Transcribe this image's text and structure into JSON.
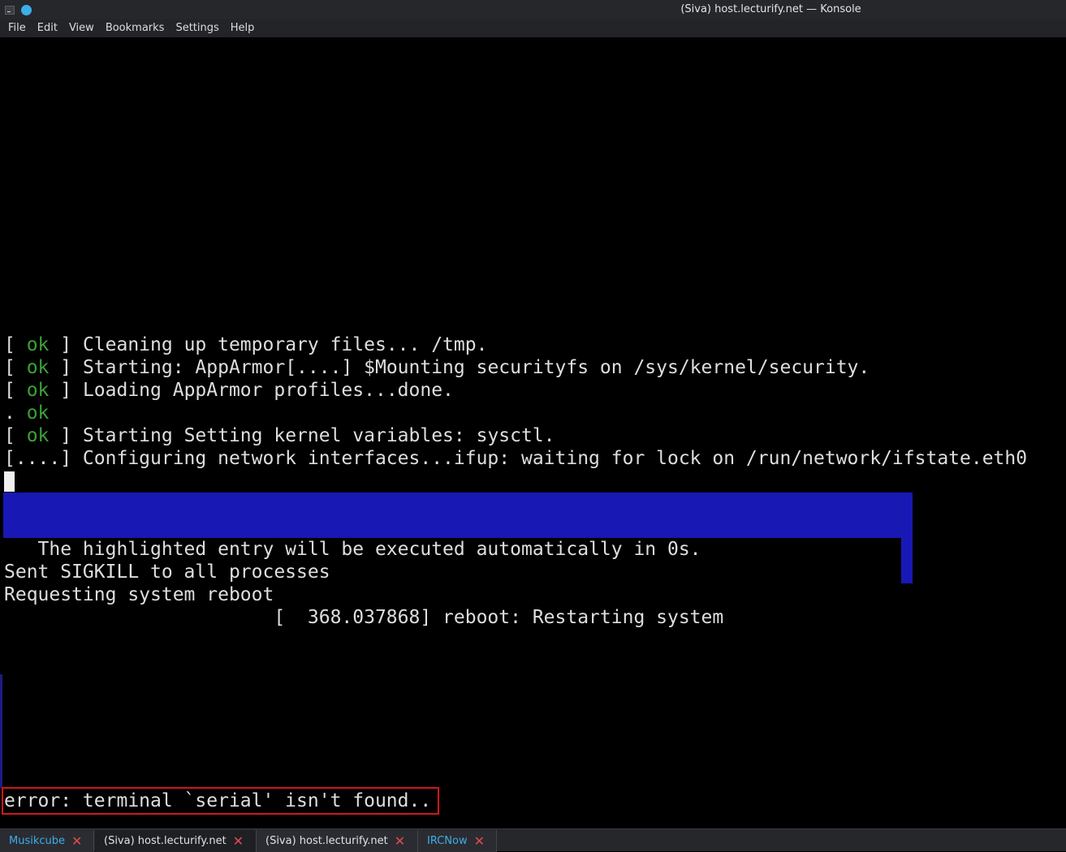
{
  "window": {
    "title": "(Siva) host.lecturify.net — Konsole",
    "app_icon": "terminal-icon",
    "pin_icon": "blue-dot-icon"
  },
  "menu": {
    "items": [
      "File",
      "Edit",
      "View",
      "Bookmarks",
      "Settings",
      "Help"
    ]
  },
  "terminal": {
    "lines": [
      {
        "prefix": "[ ",
        "status": "ok",
        "suffix": " ] Cleaning up temporary files... /tmp."
      },
      {
        "prefix": "[ ",
        "status": "ok",
        "suffix": " ] Starting: AppArmor[....] $Mounting securityfs on /sys/kernel/security."
      },
      {
        "prefix": "[ ",
        "status": "ok",
        "suffix": " ] Loading AppArmor profiles...done."
      },
      {
        "prefix": ". ",
        "status": "ok",
        "suffix": ""
      },
      {
        "prefix": "[ ",
        "status": "ok",
        "suffix": " ] Starting Setting kernel variables: sysctl."
      },
      {
        "prefix": "",
        "status": "",
        "suffix": "[....] Configuring network interfaces...ifup: waiting for lock on /run/network/ifstate.eth0"
      }
    ],
    "grub_message": "   The highlighted entry will be executed automatically in 0s.",
    "sigkill": "Sent SIGKILL to all processes",
    "reboot_request": "Requesting system reboot",
    "reboot_log": "                        [  368.037868] reboot: Restarting system",
    "error": "error: terminal `serial' isn't found.."
  },
  "tabs": [
    {
      "label": "Musikcube",
      "close_icon": "close-icon"
    },
    {
      "label": "(Siva) host.lecturify.net",
      "close_icon": "close-icon"
    },
    {
      "label": "(Siva) host.lecturify.net",
      "close_icon": "close-icon"
    },
    {
      "label": "IRCNow",
      "close_icon": "close-icon"
    }
  ],
  "colors": {
    "ok": "#3ba336",
    "grub_highlight": "#1818b5",
    "error_border": "#d01818",
    "tab_close": "#e24b4b",
    "accent": "#3daee9"
  }
}
